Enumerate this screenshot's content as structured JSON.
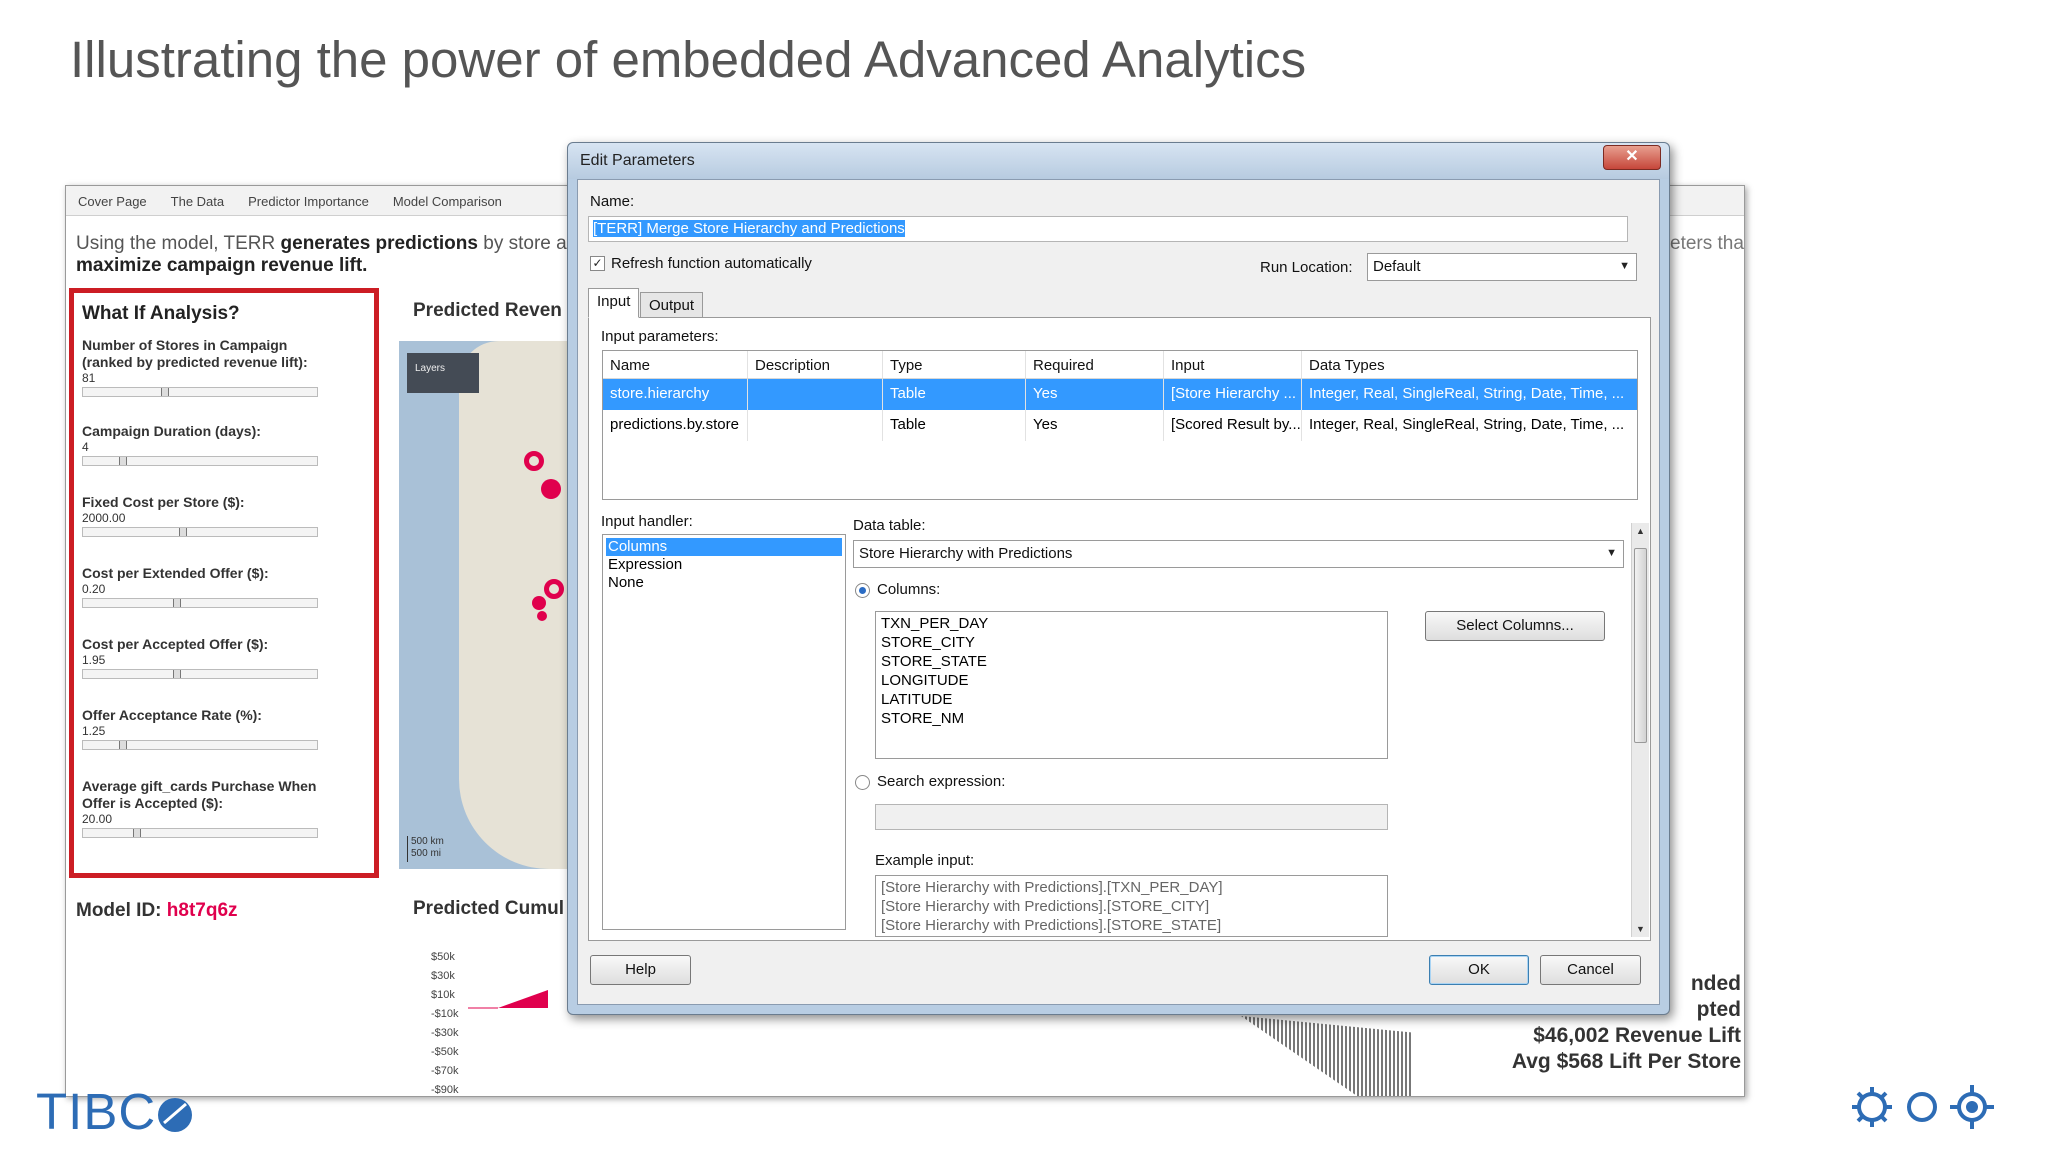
{
  "slide": {
    "title": "Illustrating the power of embedded Advanced Analytics",
    "logo_text": "TIBC",
    "accent_color": "#2d6cb5"
  },
  "dashboard": {
    "tabs": [
      "Cover Page",
      "The Data",
      "Predictor Importance",
      "Model Comparison"
    ],
    "intro_plain": "Using the model, TERR ",
    "intro_bold": "generates predictions",
    "intro_plain2": " by store ar",
    "intro_line2": "maximize campaign revenue lift.",
    "intro_right": "eters that",
    "whatif": {
      "title": "What If Analysis?",
      "params": [
        {
          "label": "Number of Stores in Campaign (ranked by predicted revenue lift):",
          "value": "81"
        },
        {
          "label": "Campaign Duration (days):",
          "value": "4"
        },
        {
          "label": "Fixed Cost per Store ($):",
          "value": "2000.00"
        },
        {
          "label": "Cost per Extended Offer ($):",
          "value": "0.20"
        },
        {
          "label": "Cost per Accepted Offer ($):",
          "value": "1.95"
        },
        {
          "label": "Offer Acceptance Rate (%):",
          "value": "1.25"
        },
        {
          "label": "Average gift_cards Purchase When Offer is Accepted ($):",
          "value": "20.00"
        }
      ]
    },
    "predicted_revenue_title": "Predicted Reven",
    "predicted_cumulative_title": "Predicted Cumul",
    "map": {
      "layers_label": "Layers",
      "scale_km": "500 km",
      "scale_mi": "500 mi"
    },
    "model_id_label": "Model ID: ",
    "model_id_value": "h8t7q6z",
    "mini_axis": [
      "$50k",
      "$30k",
      "$10k",
      "-$10k",
      "-$30k",
      "-$50k",
      "-$70k",
      "-$90k"
    ],
    "summary": [
      "nded",
      "pted",
      "$46,002 Revenue Lift",
      "Avg $568 Lift Per Store"
    ]
  },
  "dialog": {
    "title": "Edit Parameters",
    "close_glyph": "✕",
    "name_label": "Name:",
    "name_value": "[TERR] Merge Store Hierarchy and Predictions",
    "refresh_label": "Refresh function automatically",
    "refresh_checked": true,
    "run_location_label": "Run Location:",
    "run_location_value": "Default",
    "tabs": [
      "Input",
      "Output"
    ],
    "input_params_label": "Input parameters:",
    "grid": {
      "headers": [
        "Name",
        "Description",
        "Type",
        "Required",
        "Input",
        "Data Types"
      ],
      "rows": [
        [
          "store.hierarchy",
          "",
          "Table",
          "Yes",
          "[Store Hierarchy ...",
          "Integer, Real, SingleReal, String, Date, Time, ..."
        ],
        [
          "predictions.by.store",
          "",
          "Table",
          "Yes",
          "[Scored Result by...",
          "Integer, Real, SingleReal, String, Date, Time, ..."
        ]
      ]
    },
    "input_handler_label": "Input handler:",
    "input_handlers": [
      "Columns",
      "Expression",
      "None"
    ],
    "data_table_label": "Data table:",
    "data_table_value": "Store Hierarchy with Predictions",
    "columns_label": "Columns:",
    "columns": [
      "TXN_PER_DAY",
      "STORE_CITY",
      "STORE_STATE",
      "LONGITUDE",
      "LATITUDE",
      "STORE_NM"
    ],
    "select_columns_button": "Select Columns...",
    "search_expression_label": "Search expression:",
    "example_input_label": "Example input:",
    "example_input": [
      "[Store Hierarchy with Predictions].[TXN_PER_DAY]",
      "[Store Hierarchy with Predictions].[STORE_CITY]",
      "[Store Hierarchy with Predictions].[STORE_STATE]"
    ],
    "help_button": "Help",
    "ok_button": "OK",
    "cancel_button": "Cancel"
  }
}
